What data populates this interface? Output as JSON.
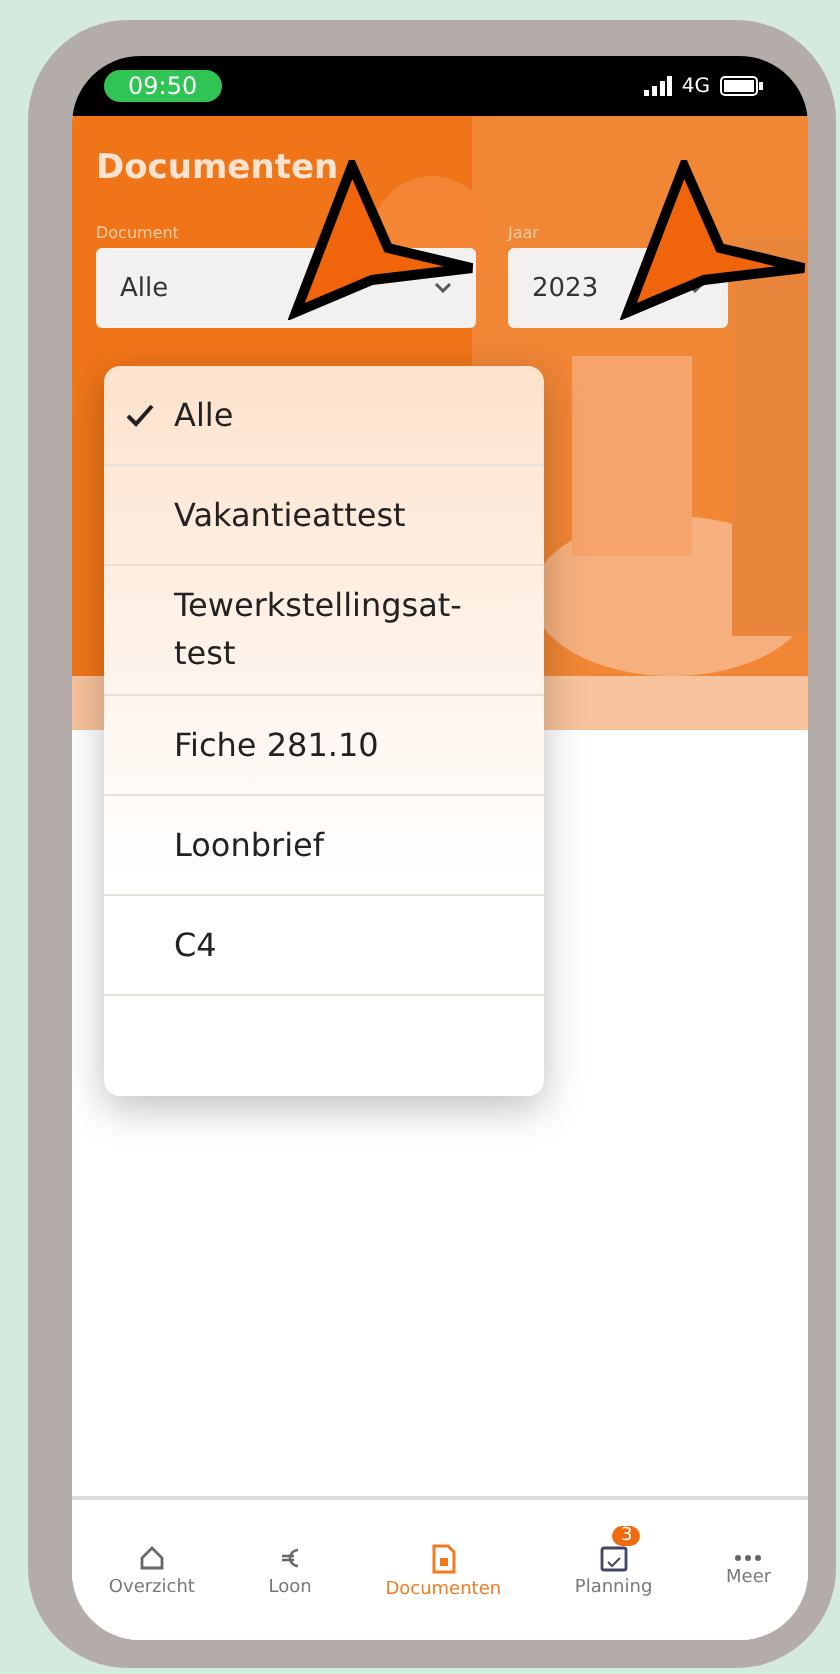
{
  "status_bar": {
    "time": "09:50",
    "network": "4G"
  },
  "header": {
    "title": "Documenten",
    "filters": [
      {
        "label": "Document",
        "value": "Alle"
      },
      {
        "label": "Jaar",
        "value": "2023"
      }
    ]
  },
  "dropdown": {
    "options": [
      {
        "label": "Alle",
        "selected": true
      },
      {
        "label": "Vakantieattest",
        "selected": false
      },
      {
        "label": "Tewerkstellingsat-test",
        "selected": false
      },
      {
        "label": "Fiche 281.10",
        "selected": false
      },
      {
        "label": "Loonbrief",
        "selected": false
      },
      {
        "label": "C4",
        "selected": false
      }
    ]
  },
  "tab_bar": [
    {
      "kind": "home",
      "label": "Overzicht",
      "selected": false
    },
    {
      "kind": "euro",
      "label": "Loon",
      "selected": false
    },
    {
      "kind": "document",
      "label": "Documenten",
      "selected": true
    },
    {
      "kind": "calendar",
      "label": "Planning",
      "selected": false,
      "badge": "3"
    },
    {
      "kind": "more",
      "label": "Meer",
      "selected": false
    }
  ]
}
